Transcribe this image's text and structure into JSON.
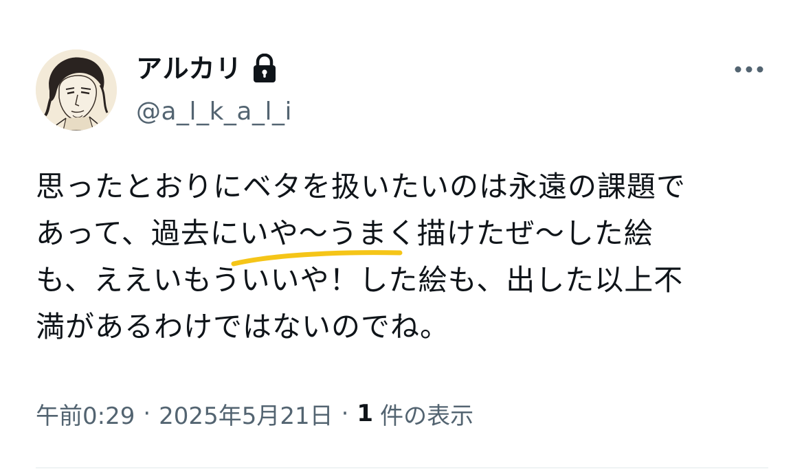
{
  "author": {
    "display_name": "アルカリ",
    "handle": "@a_l_k_a_l_i",
    "protected_icon": "lock-icon",
    "avatar": "illustrated-portrait"
  },
  "more_icon": "more-horizontal-icon",
  "tweet": {
    "lines": [
      "思ったとおりにベタを扱いたいのは永遠の課題で",
      "あって、過去にいや〜うまく描けたぜ〜した絵",
      "も、ええいもういいや！した絵も、出した以上不",
      "満があるわけではないのでね。"
    ]
  },
  "meta": {
    "time": "午前0:29",
    "separator": "·",
    "date": "2025年5月21日",
    "views_count": "1",
    "views_label": "件の表示"
  },
  "colors": {
    "text_primary": "#0f1419",
    "text_secondary": "#536471",
    "highlight_stroke": "#f5c518",
    "divider": "#eff3f4"
  }
}
